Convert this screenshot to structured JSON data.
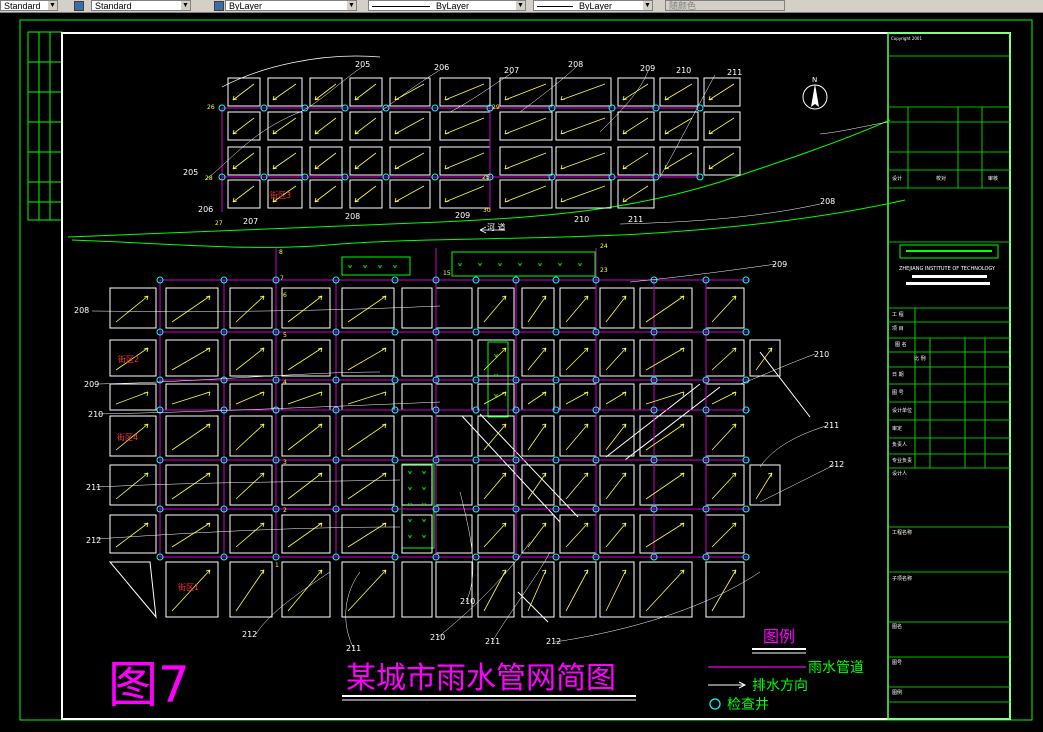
{
  "toolbar": {
    "text_style": "Standard",
    "layer_color": "ByLayer",
    "linetype": "ByLayer",
    "lineweight": "ByLayer",
    "plot_style": "随颜色"
  },
  "drawing": {
    "figure_label": "图7",
    "title": "某城市雨水管网简图",
    "legend": {
      "heading": "图例",
      "pipe": "雨水管道",
      "direction": "排水方向",
      "manhole": "检查井"
    },
    "north": "N",
    "river_label": "河 道",
    "institute": "ZHEJIANG INSTITUTE OF TECHNOLOGY",
    "copyright": "Copyright 2001",
    "district_labels": [
      "街区1",
      "街区2",
      "街区3",
      "街区4"
    ],
    "node_labels": [
      "1",
      "2",
      "3",
      "4",
      "5",
      "6",
      "7",
      "8",
      "15",
      "23",
      "24",
      "25",
      "26",
      "27",
      "28",
      "29",
      "30"
    ],
    "pipe_labels": [
      "205",
      "206",
      "207",
      "208",
      "209",
      "210",
      "211",
      "212"
    ],
    "title_block_rows": [
      "设计",
      "校对",
      "审核",
      "工 程",
      "项 目",
      "图 名",
      "比 例",
      "日 期",
      "图 号",
      "设计单位",
      "审定",
      "负责人",
      "专业负责",
      "设计人",
      "工程名称",
      "子项名称",
      "图名",
      "图号",
      "图例"
    ]
  },
  "colors": {
    "pipe": "#cc00cc",
    "block": "#ffffff",
    "arrow": "#ffff33",
    "manhole": "#00ffff",
    "frame": "#00ff00",
    "label": "#ffffff",
    "accent": "#ff00ff"
  }
}
